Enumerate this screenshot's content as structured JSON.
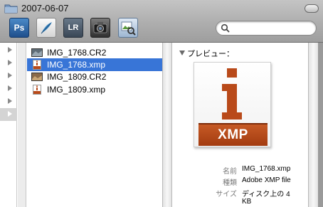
{
  "window": {
    "title": "2007-06-07"
  },
  "toolbar": {
    "apps": [
      {
        "name": "photoshop",
        "label": "Ps",
        "icon": "photoshop-icon"
      },
      {
        "name": "illustrator",
        "label": "",
        "icon": "feather-icon"
      },
      {
        "name": "lightroom",
        "label": "LR",
        "icon": "lightroom-icon"
      },
      {
        "name": "camera",
        "label": "",
        "icon": "camera-icon"
      },
      {
        "name": "preview",
        "label": "",
        "icon": "preview-icon"
      }
    ]
  },
  "search": {
    "value": "",
    "placeholder": ""
  },
  "files": [
    {
      "name": "IMG_1768.CR2",
      "icon": "photo-thumbnail-icon",
      "selected": false
    },
    {
      "name": "IMG_1768.xmp",
      "icon": "xmp-file-icon",
      "selected": true
    },
    {
      "name": "IMG_1809.CR2",
      "icon": "photo-thumbnail-icon",
      "selected": false
    },
    {
      "name": "IMG_1809.xmp",
      "icon": "xmp-file-icon",
      "selected": false
    }
  ],
  "preview": {
    "header": "プレビュー：",
    "badge_letter": "i",
    "badge_text": "XMP",
    "info": {
      "name_label": "名前",
      "name_value": "IMG_1768.xmp",
      "kind_label": "種類",
      "kind_value": "Adobe XMP file",
      "size_label": "サイズ",
      "size_value_line1": "ディスク上の 4",
      "size_value_line2": "KB"
    }
  },
  "colors": {
    "selection": "#3875d7",
    "xmp_orange": "#b94a1a"
  }
}
